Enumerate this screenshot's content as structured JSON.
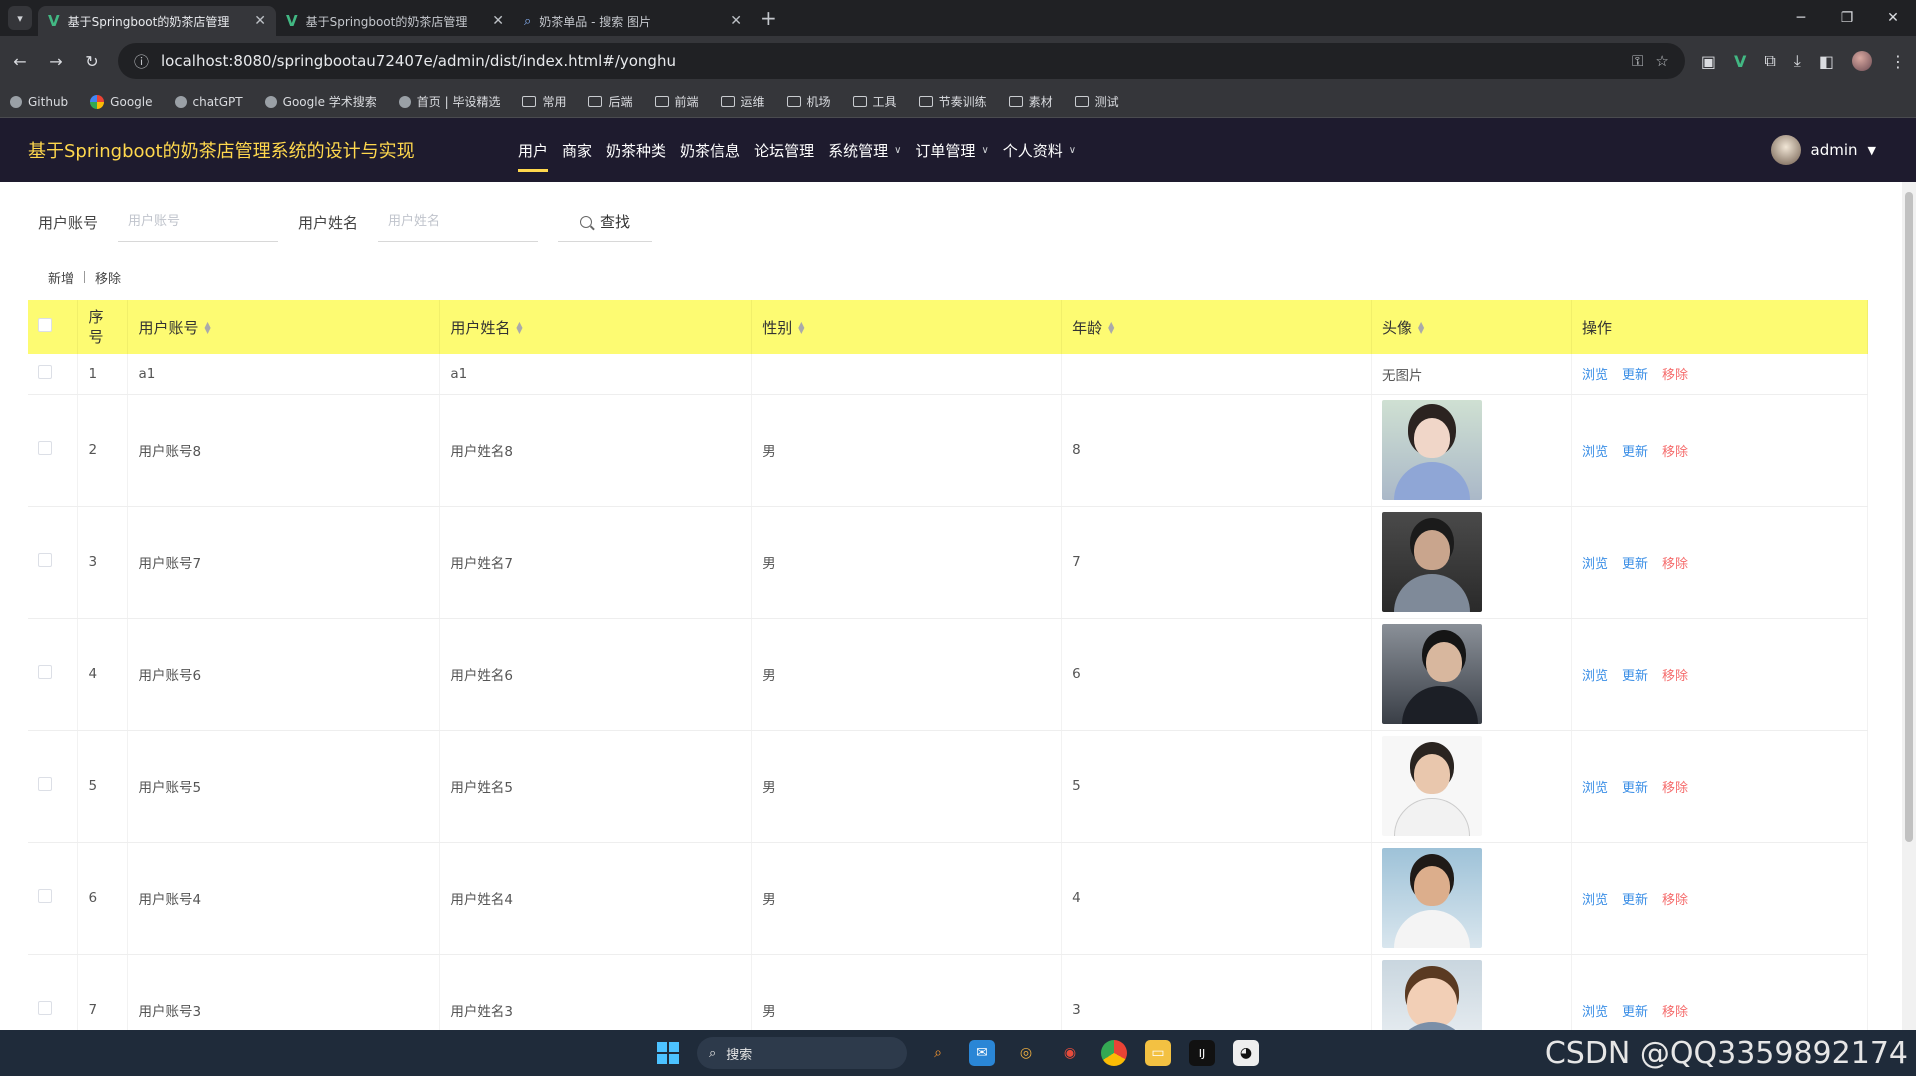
{
  "browser": {
    "tabs": [
      {
        "title": "基于Springboot的奶茶店管理",
        "favicon": "vue-icon",
        "active": true
      },
      {
        "title": "基于Springboot的奶茶店管理",
        "favicon": "vue-icon",
        "active": false
      },
      {
        "title": "奶茶单品 - 搜索 图片",
        "favicon": "search-icon",
        "active": false
      }
    ],
    "url": "localhost:8080/springbootau72407e/admin/dist/index.html#/yonghu",
    "bookmarks": [
      "Github",
      "Google",
      "chatGPT",
      "Google 学术搜索",
      "首页 | 毕设精选",
      "常用",
      "后端",
      "前端",
      "运维",
      "机场",
      "工具",
      "节奏训练",
      "素材",
      "测试"
    ]
  },
  "app": {
    "title": "基于Springboot的奶茶店管理系统的设计与实现",
    "menu": [
      {
        "label": "用户",
        "active": true,
        "dropdown": false
      },
      {
        "label": "商家",
        "active": false,
        "dropdown": false
      },
      {
        "label": "奶茶种类",
        "active": false,
        "dropdown": false
      },
      {
        "label": "奶茶信息",
        "active": false,
        "dropdown": false
      },
      {
        "label": "论坛管理",
        "active": false,
        "dropdown": false
      },
      {
        "label": "系统管理",
        "active": false,
        "dropdown": true
      },
      {
        "label": "订单管理",
        "active": false,
        "dropdown": true
      },
      {
        "label": "个人资料",
        "active": false,
        "dropdown": true
      }
    ],
    "user": {
      "name": "admin"
    }
  },
  "search": {
    "account_label": "用户账号",
    "account_placeholder": "用户账号",
    "name_label": "用户姓名",
    "name_placeholder": "用户姓名",
    "button": "查找"
  },
  "actions": {
    "add": "新增",
    "remove": "移除"
  },
  "table": {
    "columns": [
      "序号",
      "用户账号",
      "用户姓名",
      "性别",
      "年龄",
      "头像",
      "操作"
    ],
    "op_labels": {
      "view": "浏览",
      "update": "更新",
      "delete": "移除"
    },
    "rows": [
      {
        "index": "1",
        "account": "a1",
        "name": "a1",
        "gender": "",
        "age": "",
        "avatar": "无图片"
      },
      {
        "index": "2",
        "account": "用户账号8",
        "name": "用户姓名8",
        "gender": "男",
        "age": "8",
        "avatar": "photo"
      },
      {
        "index": "3",
        "account": "用户账号7",
        "name": "用户姓名7",
        "gender": "男",
        "age": "7",
        "avatar": "photo"
      },
      {
        "index": "4",
        "account": "用户账号6",
        "name": "用户姓名6",
        "gender": "男",
        "age": "6",
        "avatar": "photo"
      },
      {
        "index": "5",
        "account": "用户账号5",
        "name": "用户姓名5",
        "gender": "男",
        "age": "5",
        "avatar": "photo"
      },
      {
        "index": "6",
        "account": "用户账号4",
        "name": "用户姓名4",
        "gender": "男",
        "age": "4",
        "avatar": "photo"
      },
      {
        "index": "7",
        "account": "用户账号3",
        "name": "用户姓名3",
        "gender": "男",
        "age": "3",
        "avatar": "photo"
      }
    ]
  },
  "taskbar": {
    "search_placeholder": "搜索",
    "watermark": "CSDN @QQ3359892174"
  },
  "colors": {
    "header_bg": "#1e1b2e",
    "brand": "#ffd84d",
    "table_head": "#fdfb72",
    "link": "#3a8ee6",
    "danger": "#f56c6c"
  }
}
